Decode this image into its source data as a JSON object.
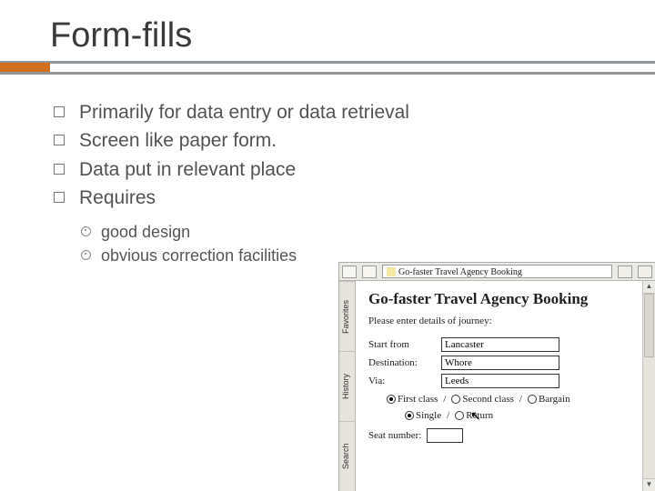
{
  "title": "Form-fills",
  "bullets": [
    "Primarily for data entry or data retrieval",
    "Screen like paper form.",
    "Data put in relevant place",
    "Requires"
  ],
  "sub_bullets": [
    "good design",
    "obvious correction facilities"
  ],
  "window": {
    "address_text": "Go-faster Travel Agency Booking",
    "side_tabs": [
      "Favorites",
      "History",
      "Search"
    ],
    "form_title": "Go-faster Travel Agency Booking",
    "instruction": "Please enter details of journey:",
    "fields": {
      "start_label": "Start from",
      "start_value": "Lancaster",
      "dest_label": "Destination:",
      "dest_value": "Whore",
      "via_label": "Via:",
      "via_value": "Leeds"
    },
    "class_options": {
      "first": "First class",
      "second": "Second class",
      "bargain": "Bargain",
      "selected": "first"
    },
    "trip_options": {
      "single": "Single",
      "return": "Return",
      "selected": "single"
    },
    "seat_label": "Seat number:",
    "seat_value": ""
  }
}
